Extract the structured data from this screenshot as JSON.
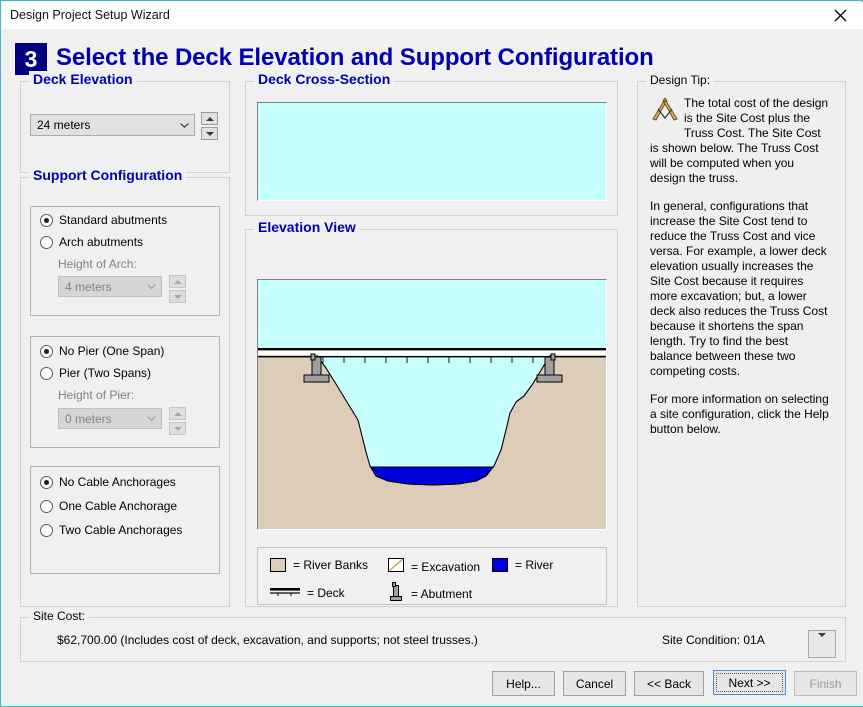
{
  "window": {
    "title": "Design Project Setup Wizard",
    "close_icon": "close-icon"
  },
  "header": {
    "step_number": "3",
    "title": "Select the Deck Elevation and Support Configuration"
  },
  "deck_elevation": {
    "group_label": "Deck Elevation",
    "value": "24 meters",
    "spin_up": "▲",
    "spin_down": "▼"
  },
  "support_configuration": {
    "group_label": "Support Configuration",
    "abutments": {
      "options": [
        {
          "label": "Standard abutments",
          "checked": true
        },
        {
          "label": "Arch abutments",
          "checked": false
        }
      ],
      "sub_label": "Height of Arch:",
      "sub_value": "4 meters",
      "sub_disabled": true
    },
    "piers": {
      "options": [
        {
          "label": "No Pier (One Span)",
          "checked": true
        },
        {
          "label": "Pier (Two Spans)",
          "checked": false
        }
      ],
      "sub_label": "Height of Pier:",
      "sub_value": "0 meters",
      "sub_disabled": true
    },
    "anchorages": {
      "options": [
        {
          "label": "No Cable Anchorages",
          "checked": true
        },
        {
          "label": "One Cable Anchorage",
          "checked": false
        },
        {
          "label": "Two Cable Anchorages",
          "checked": false
        }
      ]
    }
  },
  "deck_cross_section": {
    "group_label": "Deck Cross-Section"
  },
  "elevation_view": {
    "group_label": "Elevation View"
  },
  "legend": {
    "items": [
      {
        "swatch": "river-banks-swatch",
        "label": "= River Banks"
      },
      {
        "swatch": "excavation-swatch",
        "label": "= Excavation"
      },
      {
        "swatch": "river-swatch",
        "label": "= River"
      },
      {
        "swatch": "deck-swatch",
        "label": "= Deck"
      },
      {
        "swatch": "abutment-swatch",
        "label": "= Abutment"
      }
    ]
  },
  "design_tip": {
    "group_label": "Design Tip:",
    "icon": "drafting-compass-icon",
    "paragraphs": [
      "The total cost of the design is the Site Cost plus the Truss Cost. The Site Cost is shown below. The Truss Cost will be computed when you design the truss.",
      "In general, configurations that increase the Site Cost tend to reduce the Truss Cost and vice versa. For example, a lower deck elevation usually increases the Site Cost because it requires more excavation; but, a lower deck also reduces the Truss Cost because it shortens the span length. Try to find the best balance between these two competing costs.",
      "For more information on selecting a site configuration, click the Help button below."
    ]
  },
  "site_cost": {
    "group_label": "Site Cost:",
    "amount": "$62,700.00  (Includes cost of deck, excavation, and supports; not steel trusses.)",
    "site_condition": "Site Condition: 01A",
    "dropdown_icon": "chevron-down-icon"
  },
  "footer": {
    "buttons": [
      {
        "label": "Help...",
        "state": "normal"
      },
      {
        "label": "Cancel",
        "state": "normal"
      },
      {
        "label": "<< Back",
        "state": "normal"
      },
      {
        "label": "Next >>",
        "state": "default"
      },
      {
        "label": "Finish",
        "state": "disabled"
      }
    ]
  },
  "colors": {
    "sky": "#c8ffff",
    "ground": "#ddcdb8",
    "river": "#0000dd",
    "abutment": "#a0a0a0",
    "accent_blue": "#0000b0",
    "badge": "#000080",
    "window_border": "#4ab6cc"
  }
}
